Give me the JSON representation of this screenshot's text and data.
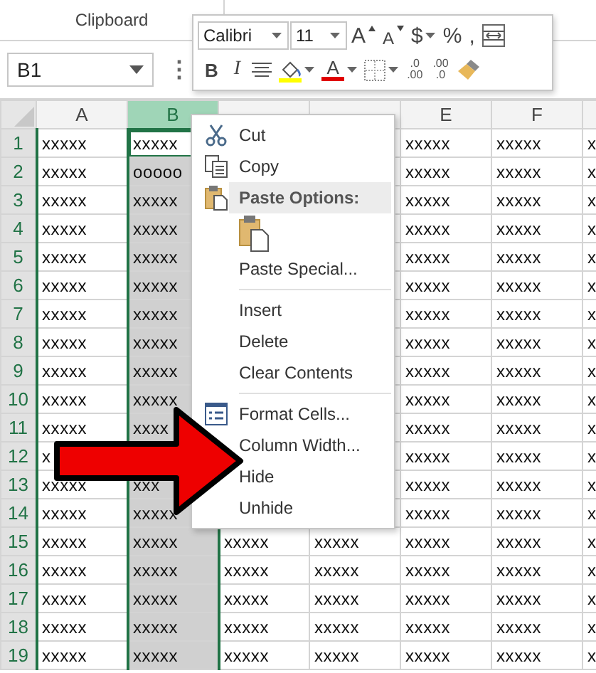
{
  "ribbon": {
    "group_label": "Clipboard"
  },
  "name_box": {
    "value": "B1",
    "more": "⋮"
  },
  "mini_toolbar": {
    "lines": [
      {
        "buttons": [
          {
            "kind": "font-select",
            "label": "Calibri"
          },
          {
            "kind": "size-select",
            "label": "11"
          },
          {
            "kind": "grow",
            "label": "A"
          },
          {
            "kind": "shrink",
            "label": "A"
          },
          {
            "kind": "split",
            "label": "$"
          },
          {
            "kind": "glyph",
            "label": "%"
          },
          {
            "kind": "glyph",
            "label": ","
          },
          {
            "kind": "wrap"
          }
        ]
      },
      {
        "buttons": [
          {
            "kind": "bold",
            "label": "B"
          },
          {
            "kind": "italic",
            "label": "I"
          },
          {
            "kind": "align"
          },
          {
            "kind": "fill",
            "color": "#ffff00"
          },
          {
            "kind": "fontcolor",
            "label": "A",
            "color": "#e00000"
          },
          {
            "kind": "borders"
          },
          {
            "kind": "decimal-more",
            "top": ".0",
            "bottom": ".00"
          },
          {
            "kind": "decimal-less",
            "top": ".00",
            "bottom": ".0"
          },
          {
            "kind": "painter"
          }
        ]
      }
    ]
  },
  "columns": [
    {
      "label": "A",
      "selected": false
    },
    {
      "label": "B",
      "selected": true
    },
    {
      "selected": false
    },
    {
      "selected": false
    },
    {
      "label": "E",
      "selected": false
    },
    {
      "label": "F",
      "selected": false
    },
    {
      "selected": false
    }
  ],
  "rows": [
    {
      "label": "1",
      "active": true,
      "cells": [
        "xxxxx",
        "xxxxx",
        null,
        null,
        "xxxxx",
        "xxxxx",
        "x"
      ]
    },
    {
      "label": "2",
      "active": false,
      "cells": [
        "xxxxx",
        "ooooo",
        null,
        null,
        "xxxxx",
        "xxxxx",
        "x"
      ]
    },
    {
      "label": "3",
      "active": false,
      "cells": [
        "xxxxx",
        "xxxxx",
        null,
        null,
        "xxxxx",
        "xxxxx",
        "x"
      ]
    },
    {
      "label": "4",
      "active": false,
      "cells": [
        "xxxxx",
        "xxxxx",
        null,
        null,
        "xxxxx",
        "xxxxx",
        "x"
      ]
    },
    {
      "label": "5",
      "active": false,
      "cells": [
        "xxxxx",
        "xxxxx",
        null,
        null,
        "xxxxx",
        "xxxxx",
        "x"
      ]
    },
    {
      "label": "6",
      "active": false,
      "cells": [
        "xxxxx",
        "xxxxx",
        null,
        null,
        "xxxxx",
        "xxxxx",
        "x"
      ]
    },
    {
      "label": "7",
      "active": false,
      "cells": [
        "xxxxx",
        "xxxxx",
        null,
        null,
        "xxxxx",
        "xxxxx",
        "x"
      ]
    },
    {
      "label": "8",
      "active": false,
      "cells": [
        "xxxxx",
        "xxxxx",
        null,
        null,
        "xxxxx",
        "xxxxx",
        "x"
      ]
    },
    {
      "label": "9",
      "active": false,
      "cells": [
        "xxxxx",
        "xxxxx",
        null,
        null,
        "xxxxx",
        "xxxxx",
        "x"
      ]
    },
    {
      "label": "10",
      "active": false,
      "cells": [
        "xxxxx",
        "xxxxx",
        null,
        null,
        "xxxxx",
        "xxxxx",
        "x"
      ]
    },
    {
      "label": "11",
      "active": false,
      "cells": [
        "xxxxx",
        "xxxx",
        null,
        null,
        "xxxxx",
        "xxxxx",
        "x"
      ]
    },
    {
      "label": "12",
      "cells": [
        "x",
        null,
        null,
        null,
        "xxxxx",
        "xxxxx",
        "x"
      ]
    },
    {
      "label": "13",
      "active": false,
      "cells": [
        "xxxxx",
        "xxx",
        null,
        null,
        "xxxxx",
        "xxxxx",
        "x"
      ]
    },
    {
      "label": "14",
      "active": false,
      "cells": [
        "xxxxx",
        "xxxxx",
        null,
        null,
        "xxxxx",
        "xxxxx",
        "x"
      ]
    },
    {
      "label": "15",
      "active": false,
      "cells": [
        "xxxxx",
        "xxxxx",
        "xxxxx",
        "xxxxx",
        "xxxxx",
        "xxxxx",
        "x"
      ]
    },
    {
      "label": "16",
      "active": false,
      "cells": [
        "xxxxx",
        "xxxxx",
        "xxxxx",
        "xxxxx",
        "xxxxx",
        "xxxxx",
        "x"
      ]
    },
    {
      "label": "17",
      "active": false,
      "cells": [
        "xxxxx",
        "xxxxx",
        "xxxxx",
        "xxxxx",
        "xxxxx",
        "xxxxx",
        "x"
      ]
    },
    {
      "label": "18",
      "active": false,
      "cells": [
        "xxxxx",
        "xxxxx",
        "xxxxx",
        "xxxxx",
        "xxxxx",
        "xxxxx",
        "x"
      ]
    },
    {
      "label": "19",
      "active": false,
      "cells": [
        "xxxxx",
        "xxxxx",
        "xxxxx",
        "xxxxx",
        "xxxxx",
        "xxxxx",
        "x"
      ]
    }
  ],
  "context_menu": {
    "items": [
      {
        "kind": "cut",
        "label": "Cut"
      },
      {
        "kind": "copy",
        "label": "Copy"
      },
      {
        "kind": "paste-header",
        "label": "Paste Options:"
      },
      {
        "kind": "paste-option"
      },
      {
        "kind": "command",
        "label": "Paste Special..."
      },
      {
        "kind": "separator"
      },
      {
        "kind": "command",
        "label": "Insert"
      },
      {
        "kind": "command",
        "label": "Delete"
      },
      {
        "kind": "command",
        "label": "Clear Contents"
      },
      {
        "kind": "separator"
      },
      {
        "kind": "format-cells",
        "label": "Format Cells..."
      },
      {
        "kind": "command",
        "label": "Column Width..."
      },
      {
        "kind": "command",
        "label": "Hide"
      },
      {
        "kind": "command",
        "label": "Unhide"
      }
    ]
  },
  "callout_arrow": {
    "kind": "arrow",
    "color": "#ee0000"
  }
}
